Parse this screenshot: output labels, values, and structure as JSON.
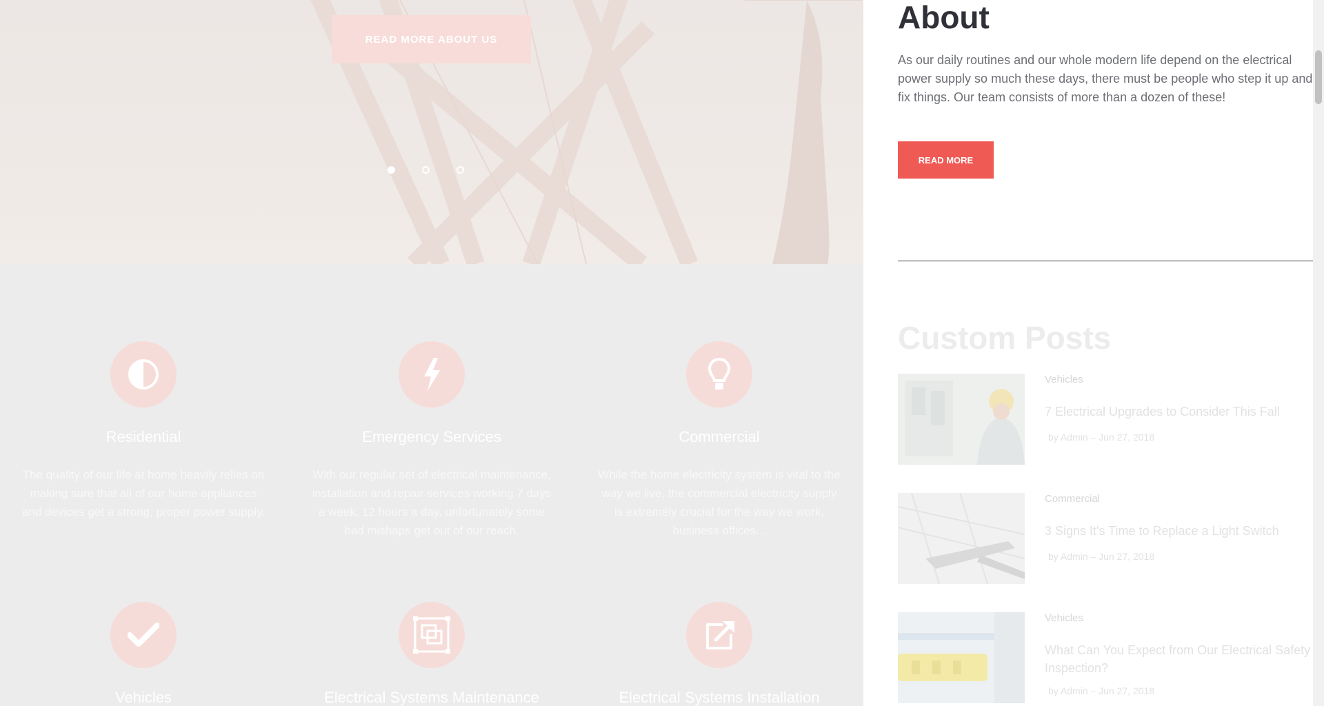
{
  "hero": {
    "button_label": "READ MORE ABOUT US",
    "slides": 3,
    "active_slide": 1
  },
  "services": [
    {
      "title": "Residential",
      "icon": "half-circle-icon",
      "text": "The quality of our life at home heavily relies on making sure that all of our home appliances and devices get a strong, proper power supply."
    },
    {
      "title": "Emergency Services",
      "icon": "lightning-bolt-icon",
      "text": "With our regular set of electrical maintenance, installation and repair services working 7 days a week, 12 hours a day, unfortunately some bad mishaps get out of our reach."
    },
    {
      "title": "Commercial",
      "icon": "light-bulb-icon",
      "text": "While the home electricity system is vital to the way we live, the commercial electricity supply is extremely crucial for the way we work, business offices..."
    },
    {
      "title": "Vehicles",
      "icon": "checkmark-icon"
    },
    {
      "title": "Electrical Systems Maintenance",
      "icon": "frame-icon"
    },
    {
      "title": "Electrical Systems Installation",
      "icon": "external-link-icon"
    }
  ],
  "panel": {
    "about_title": "About",
    "about_text": "As our daily routines and our whole modern life depend on the electrical power supply so much these days, there must be people who step it up and fix things. Our team consists of more than a dozen of these!",
    "read_more_label": "READ MORE",
    "posts_title": "Custom Posts",
    "posts": [
      {
        "category": "Vehicles",
        "title": "7 Electrical Upgrades to Consider This Fall",
        "meta": "by Admin  –  Jun 27, 2018"
      },
      {
        "category": "Commercial",
        "title": "3 Signs It's Time to Replace a Light Switch",
        "meta": "by Admin  –  Jun 27, 2018"
      },
      {
        "category": "Vehicles",
        "title": "What Can You Expect from Our Electrical Safety Inspection?",
        "meta": "by Admin  –  Jun 27, 2018"
      }
    ]
  },
  "colors": {
    "accent": "#ef5a55",
    "heading": "#2f3038",
    "body_text": "#6d6f75",
    "icon_circle": "#f6dcd8"
  }
}
